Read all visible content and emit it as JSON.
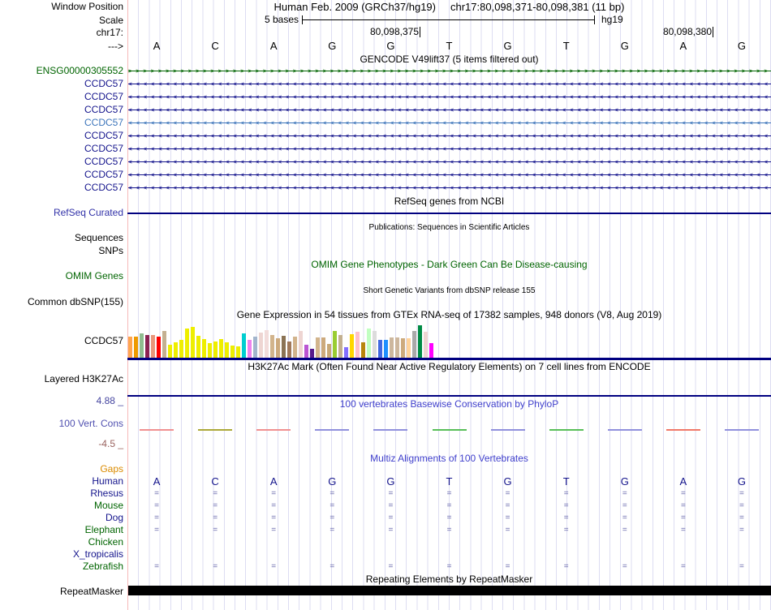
{
  "window": {
    "title": "Human Feb. 2009 (GRCh37/hg19)",
    "position": "chr17:80,098,371-80,098,381 (11 bp)",
    "assembly": "hg19",
    "scale_label": "5 bases",
    "coord_labels": [
      "80,098,375",
      "80,098,380"
    ],
    "left_labels": {
      "window_position": "Window Position",
      "scale": "Scale",
      "chrom": "chr17:",
      "strand": "--->"
    }
  },
  "bases": [
    "A",
    "C",
    "A",
    "G",
    "G",
    "T",
    "G",
    "T",
    "G",
    "A",
    "G"
  ],
  "gencode": {
    "header": "GENCODE V49lift37 (5 items filtered out)",
    "rows": [
      {
        "label": "ENSG00000305552",
        "color": "#006400",
        "direction": "right"
      },
      {
        "label": "CCDC57",
        "color": "#14148C",
        "direction": "left"
      },
      {
        "label": "CCDC57",
        "color": "#14148C",
        "direction": "left"
      },
      {
        "label": "CCDC57",
        "color": "#14148C",
        "direction": "left"
      },
      {
        "label": "CCDC57",
        "color": "#3E76BB",
        "direction": "left"
      },
      {
        "label": "CCDC57",
        "color": "#14148C",
        "direction": "left"
      },
      {
        "label": "CCDC57",
        "color": "#14148C",
        "direction": "left"
      },
      {
        "label": "CCDC57",
        "color": "#14148C",
        "direction": "left"
      },
      {
        "label": "CCDC57",
        "color": "#14148C",
        "direction": "left"
      },
      {
        "label": "CCDC57",
        "color": "#14148C",
        "direction": "left"
      }
    ]
  },
  "refseq": {
    "header": "RefSeq genes from NCBI",
    "label": "RefSeq Curated"
  },
  "publications": {
    "header": "Publications: Sequences in Scientific Articles",
    "labels": [
      "Sequences",
      "SNPs"
    ]
  },
  "omim": {
    "header": "OMIM Gene Phenotypes - Dark Green Can Be Disease-causing",
    "label": "OMIM Genes"
  },
  "dbsnp": {
    "header": "Short Genetic Variants from dbSNP release 155",
    "label": "Common dbSNP(155)"
  },
  "gtex": {
    "label": "CCDC57"
  },
  "chart_data": {
    "type": "bar",
    "title": "Gene Expression in 54 tissues from GTEx RNA-seq of 17382 samples, 948 donors (V8, Aug 2019)",
    "gene": "CCDC57",
    "legend_position": "none",
    "values": [
      26,
      26,
      30,
      28,
      28,
      26,
      33,
      16,
      19,
      22,
      36,
      38,
      27,
      23,
      18,
      20,
      23,
      19,
      15,
      14,
      30,
      22,
      26,
      31,
      34,
      28,
      24,
      27,
      20,
      26,
      33,
      16,
      11,
      25,
      25,
      17,
      33,
      28,
      13,
      29,
      32,
      19,
      36,
      33,
      22,
      22,
      25,
      25,
      24,
      24,
      33,
      40,
      32,
      18
    ],
    "colors": [
      "#FFA54F",
      "#EE9A00",
      "#8FBC8F",
      "#8B2252",
      "#E9967A",
      "#FF0000",
      "#C3B091",
      "#EEEE00",
      "#EEEE00",
      "#EEEE00",
      "#EEEE00",
      "#EEEE00",
      "#EEEE00",
      "#EEEE00",
      "#EEEE00",
      "#EEEE00",
      "#EEEE00",
      "#EEEE00",
      "#EEEE00",
      "#EEEE00",
      "#00CED1",
      "#EE82EE",
      "#A2B5CD",
      "#EED5D2",
      "#F2DCDB",
      "#D2B48C",
      "#CDAA7D",
      "#8B7355",
      "#A0785A",
      "#D2B48C",
      "#EED5D2",
      "#BA55D3",
      "#551A8B",
      "#D2B48C",
      "#CDAA7D",
      "#C8A878",
      "#9ACD32",
      "#C3B091",
      "#836FFF",
      "#FFD700",
      "#FFC0CB",
      "#B8860B",
      "#C1FFC1",
      "#DCDCDC",
      "#4169E1",
      "#1E90FF",
      "#CDB79E",
      "#CDB79E",
      "#CDAA7D",
      "#FFD39B",
      "#A9A9A9",
      "#008B45",
      "#EED5D2",
      "#FF00FF"
    ]
  },
  "h3k27ac": {
    "header": "H3K27Ac Mark (Often Found Near Active Regulatory Elements) on 7 cell lines from ENCODE",
    "label": "Layered H3K27Ac"
  },
  "conservation": {
    "header": "100 vertebrates Basewise Conservation by PhyloP",
    "label": "100 Vert. Cons",
    "max": "4.88 _",
    "min": "-4.5 _",
    "ylim": [
      -4.5,
      4.88
    ],
    "dash_colors": [
      "#F09090",
      "#ACA838",
      "#F09090",
      "#9090DC",
      "#9090DC",
      "#58BE58",
      "#9090DC",
      "#58BE58",
      "#9090DC",
      "#F07868",
      "#9090DC"
    ]
  },
  "multiz": {
    "header": "Multiz Alignments of 100 Vertebrates",
    "rows": [
      {
        "label": "Gaps",
        "color": "#DB8B00",
        "marks": "none"
      },
      {
        "label": "Human",
        "color": "#14148C",
        "marks": "bases"
      },
      {
        "label": "Rhesus",
        "color": "#14148C",
        "marks": "equals"
      },
      {
        "label": "Mouse",
        "color": "#006400",
        "marks": "equals"
      },
      {
        "label": "Dog",
        "color": "#14148C",
        "marks": "equals"
      },
      {
        "label": "Elephant",
        "color": "#006400",
        "marks": "equals"
      },
      {
        "label": "Chicken",
        "color": "#006400",
        "marks": "none"
      },
      {
        "label": "X_tropicalis",
        "color": "#14148C",
        "marks": "none"
      },
      {
        "label": "Zebrafish",
        "color": "#006400",
        "marks": "equals"
      }
    ]
  },
  "repeats": {
    "header": "Repeating Elements by RepeatMasker",
    "label": "RepeatMasker"
  },
  "colors": {
    "navy_gene": "#14148C",
    "alt_blue_gene": "#3E76BB",
    "green_gene": "#006400",
    "refseq_label": "#3232A8",
    "track_line": "#000080",
    "cons_header": "#4040CC",
    "cons_label": "#5050B0",
    "cons_max": "#4646A0",
    "cons_min": "#99625E",
    "gaps_label": "#DB8B00",
    "align_mark": "#6262AA",
    "grid": "#DDDDF2",
    "left_boundary": "#F7B9B9"
  }
}
